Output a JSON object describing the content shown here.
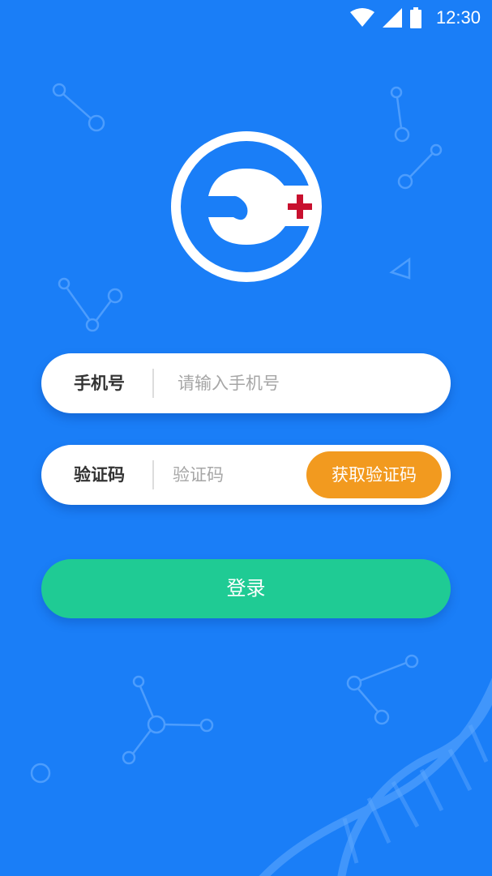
{
  "status_bar": {
    "time": "12:30",
    "icons": [
      "wifi-icon",
      "signal-icon",
      "battery-icon"
    ]
  },
  "logo": {
    "icon": "medical-logo-icon"
  },
  "phone_field": {
    "label": "手机号",
    "placeholder": "请输入手机号",
    "value": ""
  },
  "code_field": {
    "label": "验证码",
    "placeholder": "验证码",
    "value": "",
    "send_button_label": "获取验证码"
  },
  "login_button": {
    "label": "登录"
  },
  "colors": {
    "background": "#1a7ef7",
    "send_button": "#f29a1f",
    "login_button": "#1fcb94",
    "logo_cross": "#c8102e"
  }
}
